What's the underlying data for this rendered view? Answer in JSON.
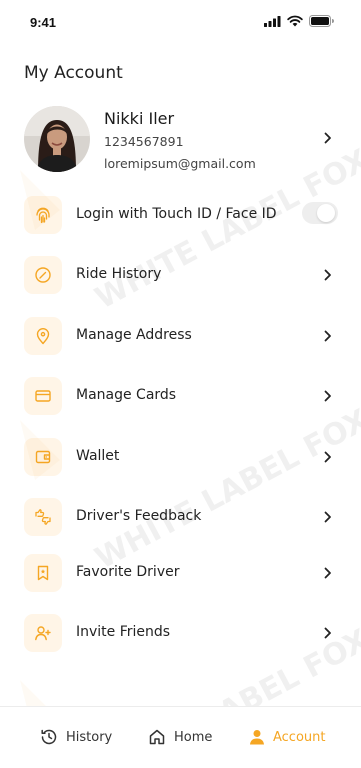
{
  "status_bar": {
    "time": "9:41"
  },
  "page": {
    "title": "My Account"
  },
  "profile": {
    "name": "Nikki Iler",
    "phone": "1234567891",
    "email": "loremipsum@gmail.com"
  },
  "menu": {
    "items": [
      {
        "label": "Login with Touch ID / Face ID",
        "icon": "fingerprint-icon",
        "control": "toggle",
        "enabled": false
      },
      {
        "label": "Ride History",
        "icon": "compass-icon",
        "control": "chevron"
      },
      {
        "label": "Manage Address",
        "icon": "location-pin-icon",
        "control": "chevron"
      },
      {
        "label": "Manage Cards",
        "icon": "credit-card-icon",
        "control": "chevron"
      },
      {
        "label": "Wallet",
        "icon": "wallet-icon",
        "control": "chevron"
      },
      {
        "label": "Driver's Feedback",
        "icon": "thumbs-feedback-icon",
        "control": "chevron"
      },
      {
        "label": "Favorite Driver",
        "icon": "bookmark-star-icon",
        "control": "chevron"
      },
      {
        "label": "Invite Friends",
        "icon": "add-user-icon",
        "control": "chevron"
      }
    ]
  },
  "watermark": {
    "text": "WHITE LABEL FOX"
  },
  "tabbar": {
    "tabs": [
      {
        "label": "History",
        "icon": "history-icon",
        "active": false
      },
      {
        "label": "Home",
        "icon": "home-icon",
        "active": false
      },
      {
        "label": "Account",
        "icon": "user-icon",
        "active": true
      }
    ]
  },
  "colors": {
    "accent": "#f5a623",
    "icon_box_bg": "#fff5e7",
    "text": "#232323"
  }
}
